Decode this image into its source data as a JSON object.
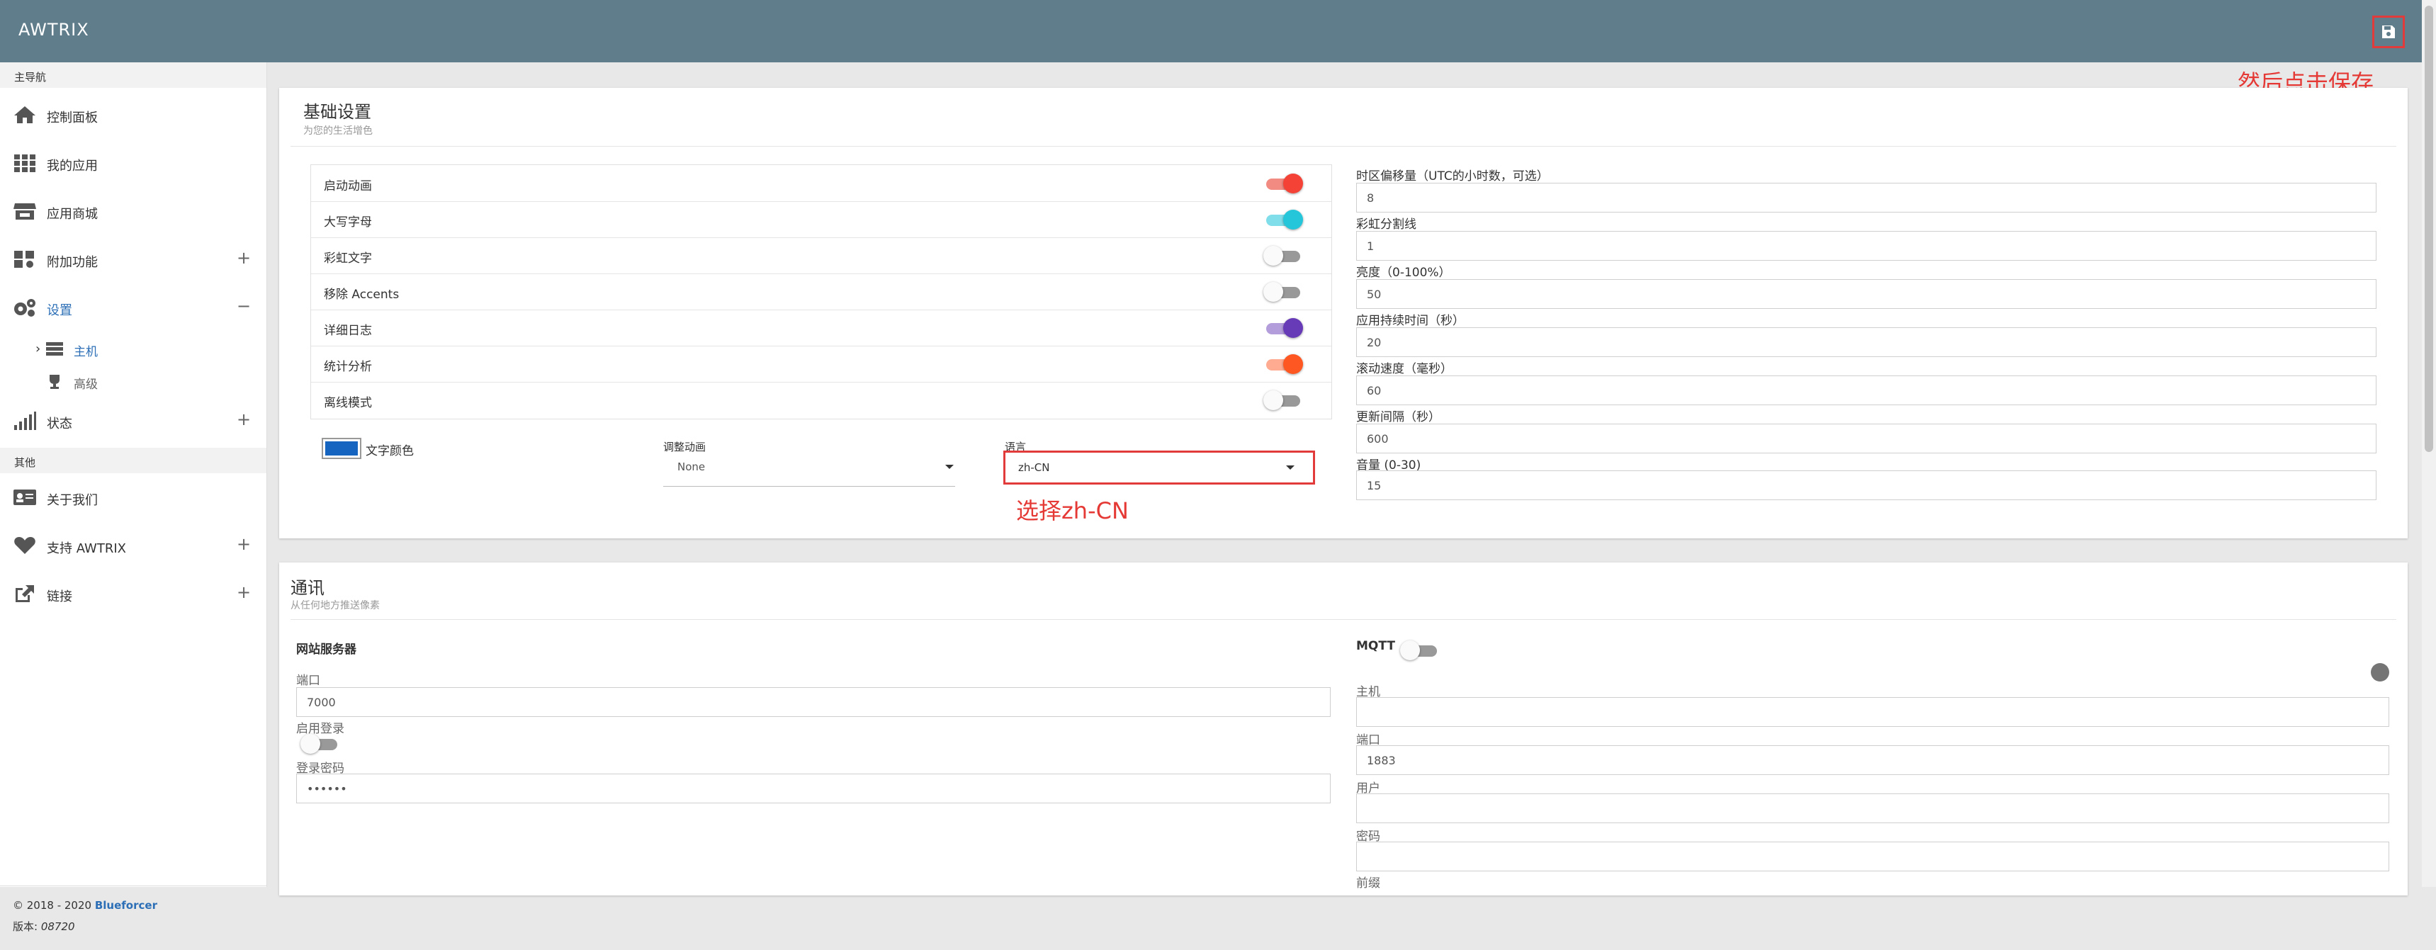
{
  "app": {
    "title": "AWTRIX"
  },
  "annotations": {
    "save_hint": "然后点击保存",
    "language_hint": "选择zh-CN"
  },
  "sidebar": {
    "section_main": "主导航",
    "section_other": "其他",
    "items": [
      {
        "label": "控制面板",
        "icon": "home-icon"
      },
      {
        "label": "我的应用",
        "icon": "grid-icon"
      },
      {
        "label": "应用商城",
        "icon": "store-icon"
      },
      {
        "label": "附加功能",
        "icon": "puzzle-icon",
        "expand": "+"
      },
      {
        "label": "设置",
        "icon": "gears-icon",
        "expand": "−"
      },
      {
        "label": "状态",
        "icon": "signal-icon",
        "expand": "+"
      },
      {
        "label": "关于我们",
        "icon": "id-card-icon"
      },
      {
        "label": "支持 AWTRIX",
        "icon": "heart-icon",
        "expand": "+"
      },
      {
        "label": "链接",
        "icon": "external-link-icon",
        "expand": "+"
      }
    ],
    "sub_items": [
      {
        "label": "主机",
        "chevron": "›"
      },
      {
        "label": "高级"
      }
    ],
    "footer": {
      "copyright": "© 2018 - 2020 ",
      "author": "Blueforcer",
      "version_label": "版本: ",
      "version": "08720"
    }
  },
  "basic": {
    "title": "基础设置",
    "subtitle": "为您的生活增色",
    "toggles": [
      {
        "label": "启动动画",
        "on": true,
        "color": "#f44336"
      },
      {
        "label": "大写字母",
        "on": true,
        "color": "#26c6da"
      },
      {
        "label": "彩虹文字",
        "on": false
      },
      {
        "label": "移除 Accents",
        "on": false
      },
      {
        "label": "详细日志",
        "on": true,
        "color": "#673ab7"
      },
      {
        "label": "统计分析",
        "on": true,
        "color": "#ff5722"
      },
      {
        "label": "离线模式",
        "on": false
      }
    ],
    "text_color_label": "文字颜色",
    "text_color": "#1565c0",
    "anim_label": "调整动画",
    "anim_value": "None",
    "lang_label": "语言",
    "lang_value": "zh-CN",
    "fields": [
      {
        "label": "时区偏移量（UTC的小时数，可选）",
        "value": "8"
      },
      {
        "label": "彩虹分割线",
        "value": "1"
      },
      {
        "label": "亮度（0-100%）",
        "value": "50"
      },
      {
        "label": "应用持续时间（秒）",
        "value": "20"
      },
      {
        "label": "滚动速度（毫秒）",
        "value": "60"
      },
      {
        "label": "更新间隔（秒）",
        "value": "600"
      },
      {
        "label": "音量 (0-30)",
        "value": "15"
      }
    ]
  },
  "comm": {
    "title": "通讯",
    "subtitle": "从任何地方推送像素",
    "web": {
      "title": "网站服务器",
      "port_label": "端口",
      "port_value": "7000",
      "login_label": "启用登录",
      "password_label": "登录密码",
      "password_value": "••••••"
    },
    "mqtt": {
      "title": "MQTT",
      "host_label": "主机",
      "port_label": "端口",
      "port_value": "1883",
      "user_label": "用户",
      "password_label": "密码",
      "prefix_label": "前缀"
    }
  }
}
